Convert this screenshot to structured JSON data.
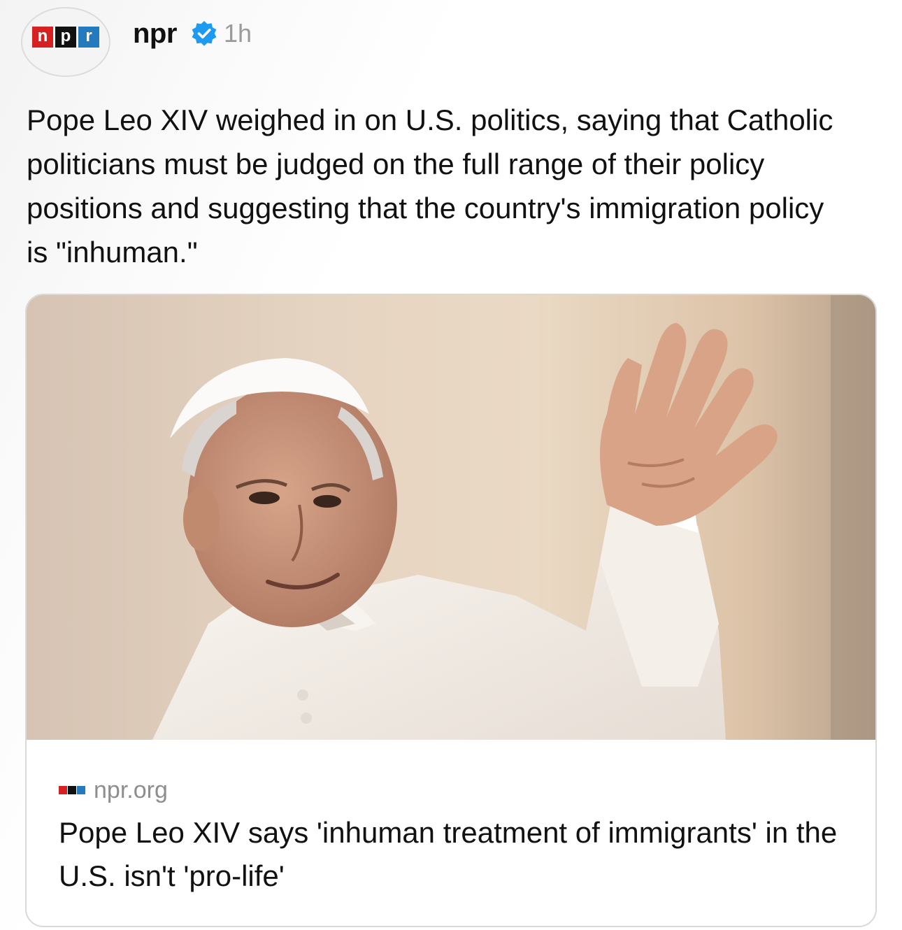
{
  "post": {
    "author_handle": "npr",
    "timestamp": "1h",
    "avatar_logo": [
      "n",
      "p",
      "r"
    ],
    "verified_icon": "verified-badge-icon",
    "caption": "Pope Leo XIV weighed in on U.S. politics, saying that Catholic politicians must be judged on the full range of their policy positions and suggesting that the country's immigration policy is \"inhuman.\""
  },
  "link_card": {
    "domain": "npr.org",
    "title": "Pope Leo XIV says 'inhuman treatment of immigrants' in the U.S. isn't 'pro-life'"
  },
  "colors": {
    "npr_red": "#d62021",
    "npr_black": "#111111",
    "npr_blue": "#237bbd",
    "verified_blue": "#1d9bf0",
    "muted_text": "#9a9a9a"
  }
}
